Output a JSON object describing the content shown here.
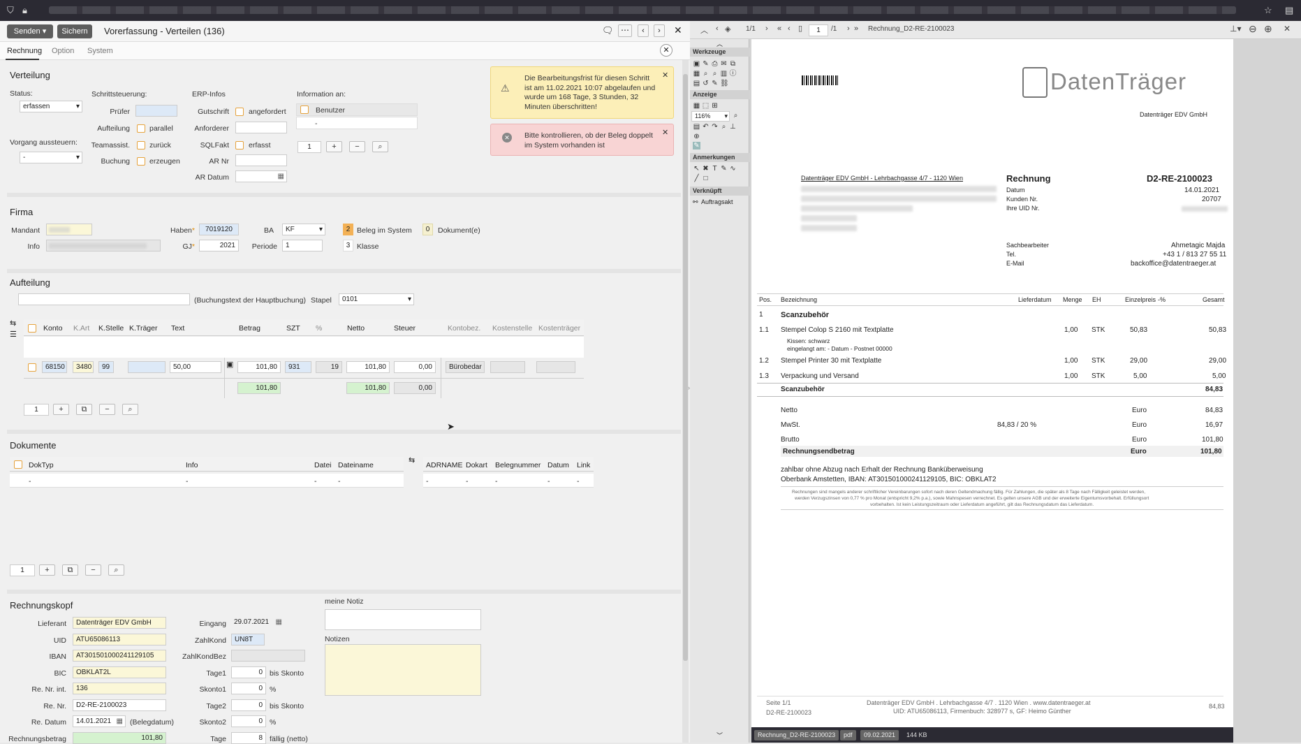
{
  "toolbar": {
    "send_label": "Senden",
    "save_label": "Sichern",
    "title": "Vorerfassung - Verteilen (136)"
  },
  "tabs": [
    "Rechnung",
    "Option",
    "System"
  ],
  "alerts": {
    "warning": "Die Bearbeitungsfrist für diesen Schritt ist am 11.02.2021 10:07 abgelaufen und wurde um 168 Tage, 3 Stunden, 32 Minuten überschritten!",
    "error": "Bitte kontrollieren, ob der Beleg doppelt im System vorhanden ist"
  },
  "verteilung": {
    "title": "Verteilung",
    "status_label": "Status:",
    "status_value": "erfassen",
    "vorgang_label": "Vorgang aussteuern:",
    "vorgang_value": "-",
    "schritt_title": "Schrittsteuerung:",
    "pruefer_label": "Prüfer",
    "aufteilung_label": "Aufteilung",
    "aufteilung_opt": "parallel",
    "teamassist_label": "Teamassist.",
    "teamassist_opt": "zurück",
    "buchung_label": "Buchung",
    "buchung_opt": "erzeugen",
    "erp_title": "ERP-Infos",
    "gutschrift_label": "Gutschrift",
    "gutschrift_opt": "angefordert",
    "anforderer_label": "Anforderer",
    "sqlfakt_label": "SQLFakt",
    "sqlfakt_opt": "erfasst",
    "arnr_label": "AR Nr",
    "ardatum_label": "AR Datum",
    "info_title": "Information an:",
    "info_col": "Benutzer",
    "info_row": "-",
    "pager": "1"
  },
  "firma": {
    "title": "Firma",
    "mandant_label": "Mandant",
    "info_label": "Info",
    "haben_label": "Haben",
    "haben_value": "7019120",
    "gj_label": "GJ",
    "gj_value": "2021",
    "ba_label": "BA",
    "ba_value": "KF",
    "periode_label": "Periode",
    "periode_value": "1",
    "beleg_count": "2",
    "beleg_label": "Beleg im System",
    "dok_count": "0",
    "dok_label": "Dokument(e)",
    "klasse_value": "3",
    "klasse_label": "Klasse"
  },
  "aufteilung": {
    "title": "Aufteilung",
    "buchungstext_label": "(Buchungstext der Hauptbuchung)",
    "stapel_label": "Stapel",
    "stapel_value": "0101",
    "headers": [
      "Konto",
      "K.Art",
      "K.Stelle",
      "K.Träger",
      "Text",
      "Betrag",
      "SZT",
      "%",
      "Netto",
      "Steuer",
      "Kontobez.",
      "Kostenstelle",
      "Kostenträger"
    ],
    "row": {
      "konto": "68150",
      "kart": "3480",
      "kstelle": "99",
      "text": "50,00",
      "betrag": "101,80",
      "szt": "931",
      "pct": "19",
      "netto": "101,80",
      "steuer": "0,00",
      "kontobez": "Bürobedar"
    },
    "sum": {
      "betrag": "101,80",
      "netto": "101,80",
      "steuer": "0,00"
    },
    "pager": "1"
  },
  "dokumente": {
    "title": "Dokumente",
    "headers": [
      "DokTyp",
      "Info",
      "Datei",
      "Dateiname",
      "ADRNAME",
      "Dokart",
      "Belegnummer",
      "Datum",
      "Link"
    ],
    "row": [
      "-",
      "-",
      "-",
      "-",
      "-",
      "-",
      "-",
      "-",
      "-"
    ],
    "pager": "1"
  },
  "rechnungskopf": {
    "title": "Rechnungskopf",
    "lieferant_label": "Lieferant",
    "lieferant": "Datenträger EDV GmbH",
    "uid_label": "UID",
    "uid": "ATU65086113",
    "iban_label": "IBAN",
    "iban": "AT301501000241129105",
    "bic_label": "BIC",
    "bic": "OBKLAT2L",
    "renrint_label": "Re. Nr. int.",
    "renrint": "136",
    "renr_label": "Re. Nr.",
    "renr": "D2-RE-2100023",
    "redatum_label": "Re. Datum",
    "redatum": "14.01.2021",
    "belegdatum_label": "(Belegdatum)",
    "betrag_label": "Rechnungsbetrag",
    "betrag": "101,80",
    "eingang_label": "Eingang",
    "eingang": "29.07.2021",
    "zahlkond_label": "ZahlKond",
    "zahlkond": "UN8T",
    "zahlkondbez_label": "ZahlKondBez",
    "tage1_label": "Tage1",
    "tage1": "0",
    "bis_skonto": "bis Skonto",
    "skonto1_label": "Skonto1",
    "skonto1": "0",
    "pct": "%",
    "tage2_label": "Tage2",
    "tage2": "0",
    "skonto2_label": "Skonto2",
    "skonto2": "0",
    "tage_label": "Tage",
    "tage": "8",
    "faellig": "fällig (netto)",
    "notiz_label": "meine Notiz",
    "notizen_label": "Notizen"
  },
  "pdf": {
    "page": "1/1",
    "page_input": "1",
    "page_total": "/1",
    "filename": "Rechnung_D2-RE-2100023",
    "zoom": "116%",
    "sections": [
      "Werkzeuge",
      "Anzeige",
      "Anmerkungen",
      "Verknüpft"
    ],
    "link_item": "Auftragsakt",
    "logo": "DatenTräger",
    "logo_sub": "Datenträger EDV GmbH",
    "sender_line": "Datenträger EDV GmbH - Lehrbachgasse 4/7 - 1120 Wien",
    "doc_title": "Rechnung",
    "doc_number": "D2-RE-2100023",
    "meta": [
      {
        "k": "Datum",
        "v": "14.01.2021"
      },
      {
        "k": "Kunden Nr.",
        "v": "20707"
      },
      {
        "k": "Ihre UID Nr.",
        "v": ""
      }
    ],
    "contact": [
      {
        "k": "Sachbearbeiter",
        "v": "Ahmetagic Majda"
      },
      {
        "k": "Tel.",
        "v": "+43 1 / 813 27 55 11"
      },
      {
        "k": "E-Mail",
        "v": "backoffice@datentraeger.at"
      }
    ],
    "cols": [
      "Pos.",
      "Bezeichnung",
      "Lieferdatum",
      "Menge",
      "EH",
      "Einzelpreis",
      "-%",
      "Gesamt"
    ],
    "group_pos": "1",
    "group": "Scanzubehör",
    "items": [
      {
        "pos": "1.1",
        "name": "Stempel Colop S 2160 mit Textplatte",
        "menge": "1,00",
        "eh": "STK",
        "preis": "50,83",
        "gesamt": "50,83"
      },
      {
        "pos": "1.2",
        "name": "Stempel Printer 30 mit Textplatte",
        "menge": "1,00",
        "eh": "STK",
        "preis": "29,00",
        "gesamt": "29,00"
      },
      {
        "pos": "1.3",
        "name": "Verpackung und Versand",
        "menge": "1,00",
        "eh": "STK",
        "preis": "5,00",
        "gesamt": "5,00"
      }
    ],
    "item_note1": "Kissen: schwarz",
    "item_note2": "eingelangt am: - Datum - Postnet 00000",
    "subtotal_label": "Scanzubehör",
    "subtotal": "84,83",
    "netto_label": "Netto",
    "netto": "84,83",
    "mwst_label": "MwSt.",
    "mwst_info": "84,83 / 20 %",
    "mwst": "16,97",
    "brutto_label": "Brutto",
    "brutto": "101,80",
    "total_label": "Rechnungsendbetrag",
    "total": "101,80",
    "currency": "Euro",
    "pay1": "zahlbar ohne Abzug nach Erhalt der Rechnung Banküberweisung",
    "pay2": "Oberbank Amstetten, IBAN: AT301501000241129105, BIC: OBKLAT2",
    "small1": "Rechnungen sind mangels anderer schriftlicher Vereinbarungen sofort nach deren Geltendmachung fällig. Für Zahlungen, die später als 8 Tage nach Fälligkeit geleistet werden,",
    "small2": "werden Verzugszinsen von 0,77 % pro Monat (entspricht 9,2% p.a.), sowie Mahnspesen verrechnet. Es gelten unsere AGB und der erweiterte Eigentumsvorbehalt. Erfüllungsort",
    "small3": "vorbehalten. Ist kein Leistungszeitraum oder Lieferdatum angeführt, gilt das Rechnungsdatum das Lieferdatum.",
    "footer_page": "Seite 1/1",
    "footer_doc": "D2-RE-2100023",
    "footer1": "Datenträger EDV GmbH . Lehrbachgasse 4/7 . 1120 Wien . www.datentraeger.at",
    "footer2": "UID: ATU65086113, Firmenbuch: 328977 s, GF: Heimo Günther",
    "footer_amount": "84,83",
    "tags": [
      "Rechnung_D2-RE-2100023",
      "pdf",
      "09.02.2021",
      "144 KB"
    ]
  }
}
